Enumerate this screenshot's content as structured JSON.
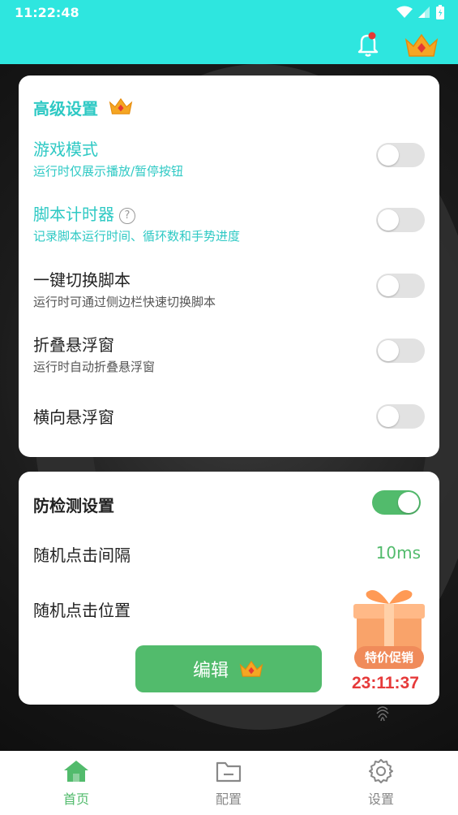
{
  "status_bar": {
    "time": "11:22:48"
  },
  "header": {
    "bell_icon": "bell-icon",
    "crown_icon": "crown-icon"
  },
  "advanced": {
    "title": "高级设置",
    "rows": [
      {
        "title": "游戏模式",
        "sub": "运行时仅展示播放/暂停按钮",
        "on": false
      },
      {
        "title": "脚本计时器",
        "help": "?",
        "sub": "记录脚本运行时间、循环数和手势进度",
        "on": false
      },
      {
        "title": "一键切换脚本",
        "sub": "运行时可通过侧边栏快速切换脚本",
        "on": false
      },
      {
        "title": "折叠悬浮窗",
        "sub": "运行时自动折叠悬浮窗",
        "on": false
      },
      {
        "title": "横向悬浮窗",
        "on": false
      }
    ]
  },
  "anti_detect": {
    "title": "防检测设置",
    "enabled": true,
    "random_interval_label": "随机点击间隔",
    "random_interval_value": "10ms",
    "random_position_label": "随机点击位置",
    "edit_label": "编辑"
  },
  "promo": {
    "label": "特价促销",
    "countdown": "23:11:37"
  },
  "nav": [
    {
      "label": "首页",
      "icon": "home-icon",
      "active": true,
      "color": "#52bb6c"
    },
    {
      "label": "配置",
      "icon": "folder-icon",
      "active": false,
      "color": "#888888"
    },
    {
      "label": "设置",
      "icon": "gear-icon",
      "active": false,
      "color": "#888888"
    }
  ],
  "colors": {
    "accent": "#2ee6df",
    "teal_text": "#2ec9c4",
    "green": "#52bb6c",
    "countdown": "#e63a3a"
  }
}
